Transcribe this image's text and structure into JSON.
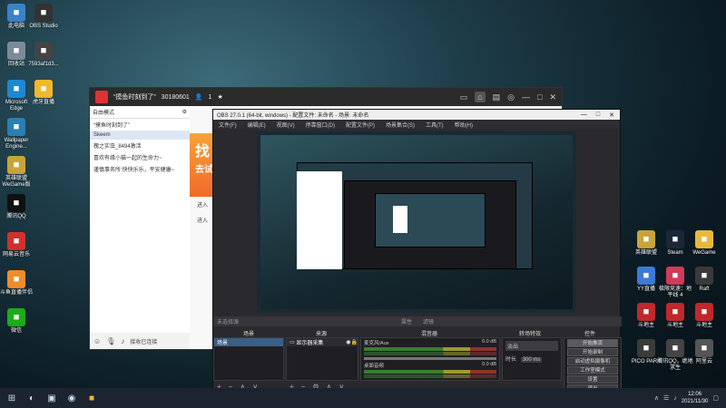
{
  "desktop_icons_left": [
    {
      "label": "此电脑",
      "icon": "computer-icon",
      "color": "#3b82c6"
    },
    {
      "label": "回收站",
      "icon": "recycle-bin-icon",
      "color": "#7a8c99"
    },
    {
      "label": "Microsoft Edge",
      "icon": "edge-icon",
      "color": "#1e88d2"
    },
    {
      "label": "Wallpaper Engine...",
      "icon": "wallpaper-engine-icon",
      "color": "#2a7fb3"
    },
    {
      "label": "英雄联盟 WeGame版",
      "icon": "lol-icon",
      "color": "#c9a43a"
    },
    {
      "label": "腾讯QQ",
      "icon": "qq-icon",
      "color": "#111111"
    },
    {
      "label": "网易云音乐",
      "icon": "netease-music-icon",
      "color": "#d0312d"
    },
    {
      "label": "斗鱼直播伴侣",
      "icon": "douyu-icon",
      "color": "#f08c2a"
    },
    {
      "label": "微信",
      "icon": "wechat-icon",
      "color": "#1aad19"
    }
  ],
  "desktop_icons_col2": [
    {
      "label": "OBS Studio",
      "icon": "obs-icon",
      "color": "#333333"
    },
    {
      "label": "7593af1d3...",
      "icon": "image-file-icon",
      "color": "#444444"
    },
    {
      "label": "虎牙直播",
      "icon": "huya-icon",
      "color": "#f3b72e"
    }
  ],
  "desktop_icons_right": [
    {
      "label": "英雄联盟",
      "icon": "lol-icon",
      "color": "#c9a43a"
    },
    {
      "label": "Steam",
      "icon": "steam-icon",
      "color": "#1b2838"
    },
    {
      "label": "WeGame",
      "icon": "wegame-icon",
      "color": "#e8b93a"
    },
    {
      "label": "YY直播",
      "icon": "yy-icon",
      "color": "#3b7bd6"
    },
    {
      "label": "极限竞速：地平线 4",
      "icon": "forza-icon",
      "color": "#d23a5a"
    },
    {
      "label": "Raft",
      "icon": "raft-icon",
      "color": "#3a3a3a"
    },
    {
      "label": "斗地主",
      "icon": "card-game-icon",
      "color": "#c0282c"
    },
    {
      "label": "斗地主",
      "icon": "card-game-icon",
      "color": "#c0282c"
    },
    {
      "label": "斗地主",
      "icon": "card-game-icon",
      "color": "#c0282c"
    },
    {
      "label": "PICO PARK",
      "icon": "pico-park-icon",
      "color": "#3b3b3b"
    },
    {
      "label": "腾讯QQ，绝地求生",
      "icon": "pubg-icon",
      "color": "#444444"
    },
    {
      "label": "阿里云",
      "icon": "aliyun-icon",
      "color": "#555555"
    }
  ],
  "taskbar": {
    "start_icon": "windows-start-icon",
    "apps": [
      "edge-icon",
      "file-explorer-icon",
      "obs-icon",
      "huya-icon"
    ],
    "time": "12:06",
    "date": "2021/11/30"
  },
  "live_window": {
    "title": "“摸鱼时刻到了”",
    "room_id": "30180601",
    "viewers": "1",
    "chat_header": "自由模式",
    "chat_rows": [
      "“摸鱼时刻到了”",
      "Skeem",
      "槐之实虫_8494激活",
      "喜欢有缘小猫一起的生命力~",
      "谨慎事务所 快快乐乐，平安健康~"
    ],
    "mid_lines": [
      "进入",
      "进入"
    ],
    "ad_text": "找",
    "ad_sub": "去试",
    "bottom_label": "接收已连接"
  },
  "obs": {
    "title": "OBS 27.0.1 (64-bit, windows) - 配置文件: 未命名 - 场景: 未命名",
    "menu": [
      "文件(F)",
      "编辑(E)",
      "视图(V)",
      "停靠窗口(D)",
      "配置文件(P)",
      "场景集合(S)",
      "工具(T)",
      "帮助(H)"
    ],
    "selected_source": "未选择源",
    "toolbar": [
      "属性",
      "滤镜"
    ],
    "dock_headers": [
      "场景",
      "来源",
      "混音器",
      "转场特效",
      "控件"
    ],
    "scenes": [
      "场景"
    ],
    "sources": [
      "显示器采集"
    ],
    "mixer": [
      {
        "name": "麦克风/Aux",
        "value": "0.0 dB"
      },
      {
        "name": "桌面音频",
        "value": "0.0 dB"
      }
    ],
    "transition": {
      "type": "淡出",
      "duration_label": "时长",
      "duration": "300 ms"
    },
    "controls": [
      "开始推流",
      "开始录制",
      "启动虚拟摄像机",
      "工作室模式",
      "设置",
      "退出"
    ]
  }
}
